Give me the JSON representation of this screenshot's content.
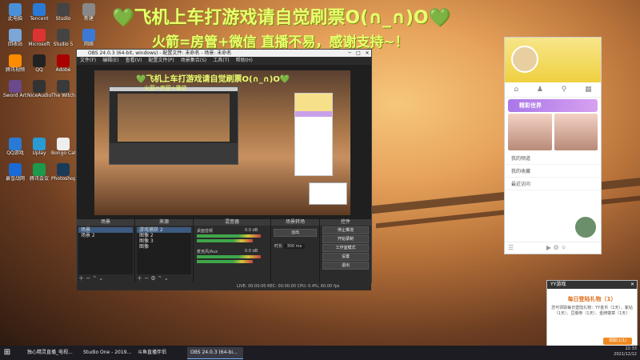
{
  "overlay": {
    "title": "💚飞机上车打游戏请自觉刷票O(∩_∩)O💚",
    "subtitle": "火箭=房管+微信 直播不易，感谢支持~！"
  },
  "desktop_icons": [
    {
      "label": "此电脑",
      "color": "#4a90d9"
    },
    {
      "label": "Tencent",
      "color": "#2a7ad5"
    },
    {
      "label": "Studio",
      "color": "#444"
    },
    {
      "label": "新建",
      "color": "#888"
    },
    {
      "label": "回收站",
      "color": "#7aa7d8"
    },
    {
      "label": "Microsoft",
      "color": "#d33"
    },
    {
      "label": "Studio 5",
      "color": "#444"
    },
    {
      "label": "网络",
      "color": "#3a7ad5"
    },
    {
      "label": "腾讯视频",
      "color": "#ff8c00"
    },
    {
      "label": "QQ",
      "color": "#222"
    },
    {
      "label": "Adobe",
      "color": "#a00"
    },
    {
      "label": "Steam",
      "color": "#1b2838"
    },
    {
      "label": "Sword Art Online",
      "color": "#6a4a8a"
    },
    {
      "label": "NiceAudio",
      "color": "#333"
    },
    {
      "label": "The Witcher 3",
      "color": "#3a3a3a"
    },
    {
      "label": "网易UU",
      "color": "#e33"
    },
    {
      "label": "QQ游戏",
      "color": "#2a7ad5"
    },
    {
      "label": "Uplay",
      "color": "#2a9ad5"
    },
    {
      "label": "Bongo Cat",
      "color": "#eee"
    },
    {
      "label": "WeGame",
      "color": "#d04"
    },
    {
      "label": "暴雪战网",
      "color": "#1a6ad5"
    },
    {
      "label": "腾讯会议",
      "color": "#1a9a4a"
    },
    {
      "label": "Photoshop",
      "color": "#1a3a5a"
    }
  ],
  "obs": {
    "window_title": "OBS 24.0.3 (64-bit, windows) - 配置文件: 未命名 - 场景: 未命名",
    "menu": [
      "文件(F)",
      "编辑(E)",
      "查看(V)",
      "配置文件(P)",
      "场景集合(S)",
      "工具(T)",
      "帮助(H)"
    ],
    "preview_overlay": "💚飞机上车打游戏请自觉刷票O(∩_∩)O💚",
    "preview_overlay_sub": "火箭=房管+微信",
    "scenes": {
      "header": "场景",
      "items": [
        "场景",
        "场景 2"
      ]
    },
    "sources": {
      "header": "来源",
      "items": [
        "游戏捕获 2",
        "图像 2",
        "图像 3",
        "图像"
      ]
    },
    "mixer": {
      "header": "混音器",
      "tracks": [
        {
          "name": "桌面音频",
          "db": "0.0 dB"
        },
        {
          "name": "麦克风/Aux",
          "db": "0.0 dB"
        }
      ]
    },
    "transitions": {
      "header": "场景转场",
      "type": "淡出",
      "duration_label": "时长",
      "duration": "300 ms"
    },
    "controls": {
      "header": "控件",
      "buttons": [
        "停止推流",
        "开始录制",
        "工作室模式",
        "设置",
        "退出"
      ]
    },
    "status": "LIVE: 00:00:00   REC: 00:00:00   CPU: 0.4%, 60.00 fps"
  },
  "yy_panel": {
    "tabs": [
      "⌂",
      "♟",
      "⚲",
      "▦"
    ],
    "banner": "精彩世界",
    "list": [
      "我的频道",
      "我的收藏",
      "最近访问"
    ]
  },
  "notification": {
    "header": "YY游戏",
    "title": "每日登陆礼物（1）",
    "body": "您可领取每日登陆礼物：YY金币（1天）、紫钻（1天）、豆瓣券（1天）、金牌徽章（1天）",
    "button": "领取(1/1)"
  },
  "taskbar": {
    "items": [
      {
        "label": "独心精灵直播_电视...",
        "active": false
      },
      {
        "label": "Studio One - 2019...",
        "active": false
      },
      {
        "label": "斗鱼直播伴侣",
        "active": false
      },
      {
        "label": "OBS 24.0.3 (64-bi...",
        "active": true
      }
    ],
    "time": "22:33",
    "date": "2021/12/12"
  }
}
